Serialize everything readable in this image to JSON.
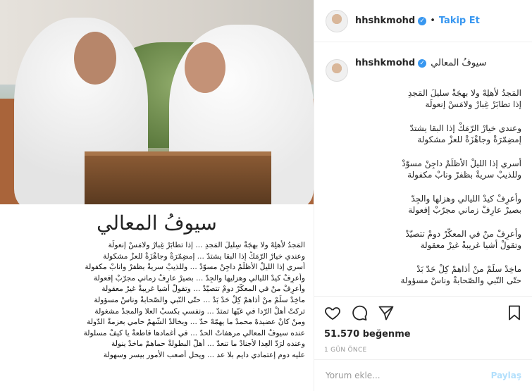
{
  "post": {
    "username": "hhshkmohd",
    "follow_label": "Takip Et",
    "dot": "•",
    "poem_title": "سيوفُ المعالي",
    "poem_lines": [
      "المَجدُ لأهلِهْ ولا بهجَةْ سِليلَ المَجدِ ... إذا تطابَرْ غِبارْ ولامَسْ إنعولَة",
      "وعندي خيارْ الرّمَكْ إذا البقا يشتدّ ... إمضِمّرَةْ وجاهْزَةْ للعزْ مشكولة",
      "أسري إذا الليلْ الأظلَمْ داجِنْ مسوّدْ ... وللذيبْ سريةْ بظفرْ وانابْ مكفولة",
      "وأعرِفْ كيدْ الليالي وهزليها والجِدّ ... بصيرْ عارِفْ زماني مجرّبْ إفعولة",
      "وأعرِفْ منْ في المعكّرْ دومْ تتصيّدْ ... وتقولْ أشيا غريبةْ غيرْ معقولة",
      "ماخِدْ سلَمْ منْ أذاهمْ كِلْ حَدْ بَدْ ... حتّى النّبي والصّحابةْ وناسْ مسؤولة",
      "تركتْ أهلْ الرّدا في غيّها تمتدّ ... ونفسي بكسبْ العلا والمجدْ مشغولة",
      "ومنْ كانْ عضيدهْ محمدْ ما يهمّهْ حدّ ... وبخالدْ الشّهمْ حامي بعزمةْ الدّولة",
      "عنده سيوفْ المعالي مرهفاتْ الحدّ ... في أغمادها قاطعةْ يا كيفْ مسلولة",
      "وعنده لرَدّ العِدا لأجنادْ ما تنعدّ ... أهلْ البطولةْ حماهمْ ماخدْ ينولة",
      "عليه دوم إعتمادي دايم بلا عد ... ويحل أصعب الأمور بيسر وسهولة"
    ],
    "caption_stanzas": [
      [
        "المَجدُ لأهلِهْ ولا بهجَةْ سليلَ المَجدِ",
        "إذا تطابَرْ غِبارْ ولامَسْ إنعولَة"
      ],
      [
        "وعندي خيارْ الرّمَكْ إذا البقا يشتدّ",
        "إمضِمّرَةْ وجاهْزَةْ للعزْ مشكولة"
      ],
      [
        "أسري إذا الليلْ الأظلَمْ داجِنْ مسوّدْ",
        "وللذيبْ سريةْ بظفرْ ونابْ مكفولة"
      ],
      [
        "وأعرِفْ كيدْ الليالي وهزلها والجِدّ",
        "بصيرْ عارِفْ زماني مجرّبْ إفعولة"
      ],
      [
        "وأعرِفْ منْ في المعكّرْ دومْ تتصيّدْ",
        "وتقولْ أشيا غريبةْ غيرْ معقولة"
      ],
      [
        "ماخِدْ سلَمْ منْ أذاهمْ كِلْ حَدّ بَدْ",
        "حتّى النّبي والصّحابةْ وناسْ مسؤولة"
      ]
    ],
    "likes": "51.570 beğenme",
    "time": "1 GÜN ÖNCE",
    "comment_placeholder": "Yorum ekle...",
    "post_label": "Paylaş"
  },
  "colors": {
    "accent": "#3897f0",
    "text": "#262626",
    "muted": "#999999",
    "post_disabled": "#b2dffc"
  },
  "icons": [
    "heart-icon",
    "comment-icon",
    "share-icon",
    "bookmark-icon",
    "verified-badge-icon"
  ]
}
